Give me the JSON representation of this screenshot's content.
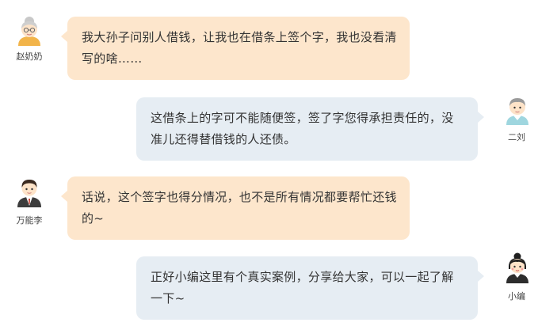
{
  "messages": [
    {
      "speaker": "赵奶奶",
      "avatar_icon": "grandma-avatar-icon",
      "side": "left",
      "text": "我大孙子问别人借钱，让我也在借条上签个字，我也没看清写的啥……"
    },
    {
      "speaker": "二刘",
      "avatar_icon": "young-man-avatar-icon",
      "side": "right",
      "text": "这借条上的字可不能随便签，签了字您得承担责任的，没准儿还得替借钱的人还债。"
    },
    {
      "speaker": "万能李",
      "avatar_icon": "lawyer-avatar-icon",
      "side": "left",
      "text": "话说，这个签字也得分情况，也不是所有情况都要帮忙还钱的~"
    },
    {
      "speaker": "小编",
      "avatar_icon": "editor-girl-avatar-icon",
      "side": "right",
      "text": "正好小编这里有个真实案例，分享给大家，可以一起了解一下~"
    }
  ],
  "colors": {
    "left_bubble": "#fde6cc",
    "right_bubble": "#e6edf3",
    "text": "#333333"
  }
}
